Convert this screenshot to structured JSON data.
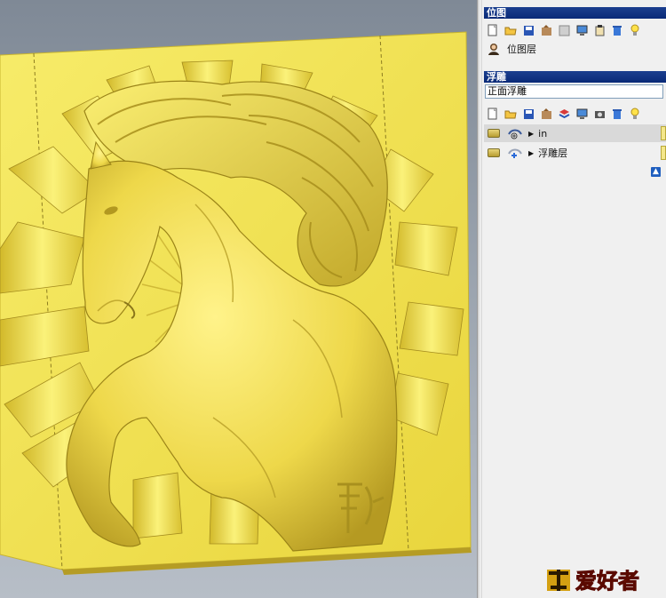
{
  "bitmap_panel": {
    "header": "位图",
    "toolbar_icons": [
      "new-icon",
      "open-folder-icon",
      "save-icon",
      "import-icon",
      "blank-icon",
      "monitor-icon",
      "paste-icon",
      "delete-icon",
      "lightbulb-icon"
    ],
    "layers": [
      {
        "name": "位图层",
        "icon": "portrait-icon"
      }
    ]
  },
  "relief_panel": {
    "header": "浮雕",
    "dropdown_value": "正面浮雕",
    "toolbar_icons": [
      "new-icon",
      "open-folder-icon",
      "save-icon",
      "import-icon",
      "layers-icon",
      "monitor-icon",
      "camera-icon",
      "delete-icon",
      "lightbulb-icon"
    ],
    "layers": [
      {
        "name": "in",
        "selected": true
      },
      {
        "name": "浮雕层",
        "selected": false
      }
    ]
  },
  "viewport": {
    "relief_color": "#f2e34e",
    "background_color": "#8c96a2"
  },
  "logo": {
    "text": "爱好者"
  }
}
